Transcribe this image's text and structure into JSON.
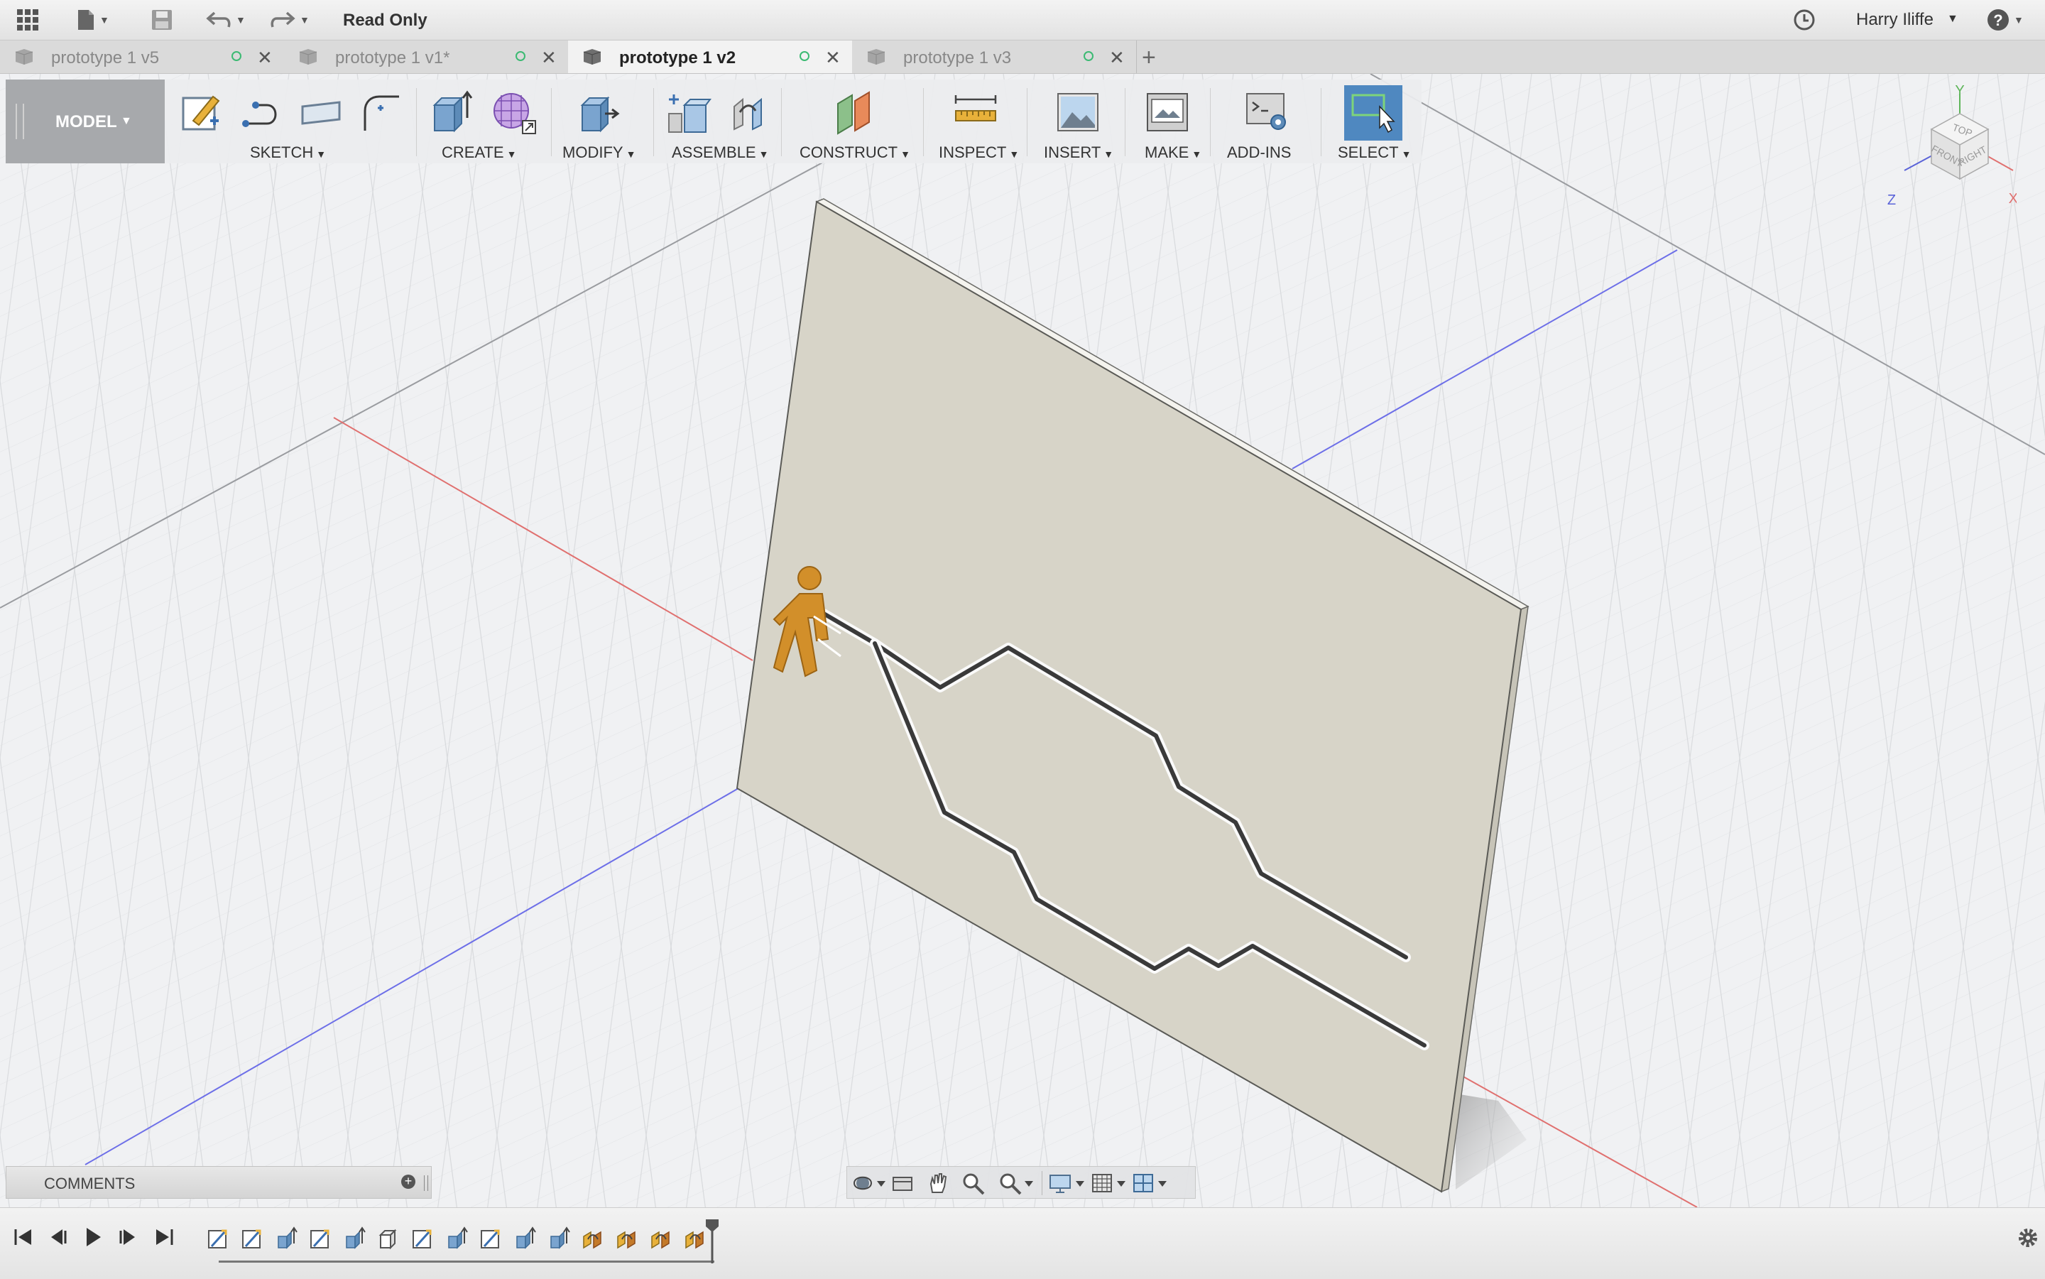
{
  "titlebar": {
    "status": "Read Only",
    "user": "Harry Iliffe"
  },
  "tabs": [
    {
      "label": "prototype 1 v5",
      "active": false
    },
    {
      "label": "prototype 1 v1*",
      "active": false
    },
    {
      "label": "prototype 1 v2",
      "active": true
    },
    {
      "label": "prototype 1 v3",
      "active": false
    }
  ],
  "toolbar": {
    "mode": "MODEL",
    "groups": {
      "sketch": "SKETCH",
      "create": "CREATE",
      "modify": "MODIFY",
      "assemble": "ASSEMBLE",
      "construct": "CONSTRUCT",
      "inspect": "INSPECT",
      "insert": "INSERT",
      "make": "MAKE",
      "addins": "ADD-INS",
      "select": "SELECT"
    }
  },
  "viewcube": {
    "faces": [
      "TOP",
      "FRONT",
      "RIGHT"
    ],
    "axes": {
      "x": "X",
      "y": "Y",
      "z": "Z"
    }
  },
  "comments": {
    "label": "COMMENTS"
  },
  "timeline": {
    "steps": [
      "sketch",
      "sketch",
      "extrude",
      "sketch",
      "extrude",
      "body",
      "sketch",
      "extrude",
      "sketch",
      "extrude",
      "extrude",
      "joint",
      "joint",
      "joint",
      "joint"
    ]
  },
  "colors": {
    "accent": "#4f88c0",
    "panel": "#d7d4c8",
    "figure": "#d28f2a",
    "axis_x": "#e0706f",
    "axis_z": "#6d6fe8"
  }
}
